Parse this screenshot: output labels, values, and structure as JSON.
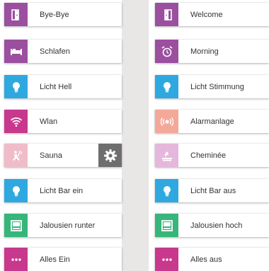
{
  "colors": {
    "purple": "#9b4f9f",
    "blue": "#2fa8e0",
    "magenta": "#c8388c",
    "pink_light": "#f0bcc9",
    "salmon": "#f4a89a",
    "lavender": "#e6b7dc",
    "green": "#37b57a",
    "gear_gray": "#6e6e6e",
    "page_bg": "#e9e7e6",
    "label_text": "#333333"
  },
  "left_buttons": [
    {
      "label": "Bye-Bye",
      "icon": "door-exit-icon",
      "color": "purple"
    },
    {
      "label": "Schlafen",
      "icon": "bed-icon",
      "color": "purple"
    },
    {
      "label": "Licht Hell",
      "icon": "lightbulb-icon",
      "color": "blue"
    },
    {
      "label": "Wlan",
      "icon": "wifi-icon",
      "color": "magenta"
    },
    {
      "label": "Sauna",
      "icon": "sauna-icon",
      "color": "pink_light",
      "has_settings": true,
      "settings_icon": "gear-icon"
    },
    {
      "label": "Licht Bar ein",
      "icon": "lightbulb-icon",
      "color": "blue"
    },
    {
      "label": "Jalousien runter",
      "icon": "blinds-icon",
      "color": "green"
    },
    {
      "label": "Alles Ein",
      "icon": "dots-icon",
      "color": "magenta"
    }
  ],
  "right_buttons": [
    {
      "label": "Welcome",
      "icon": "door-enter-icon",
      "color": "purple"
    },
    {
      "label": "Morning",
      "icon": "alarm-clock-icon",
      "color": "purple"
    },
    {
      "label": "Licht Stimmung",
      "icon": "lightbulb-icon",
      "color": "blue"
    },
    {
      "label": "Alarmanlage",
      "icon": "alarm-siren-icon",
      "color": "salmon"
    },
    {
      "label": "Cheminée",
      "icon": "fireplace-icon",
      "color": "lavender"
    },
    {
      "label": "Licht Bar aus",
      "icon": "lightbulb-icon",
      "color": "blue"
    },
    {
      "label": "Jalousien hoch",
      "icon": "blinds-icon",
      "color": "green"
    },
    {
      "label": "Alles aus",
      "icon": "dots-icon",
      "color": "magenta"
    }
  ]
}
